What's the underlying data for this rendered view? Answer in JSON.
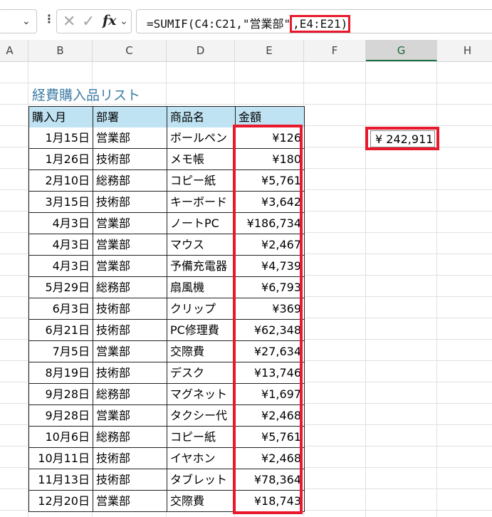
{
  "formula_bar": {
    "formula_prefix": "=SUMIF(C4:C21,\"営業部\"",
    "formula_highlight": ",E4:E21)",
    "fx_label": "fx"
  },
  "icons": {
    "namebox": "chevron-down-icon",
    "menu": "vertical-dots-icon",
    "cancel": "cancel-x-icon",
    "enter": "checkmark-icon",
    "function": "fx-icon"
  },
  "columns": [
    "A",
    "B",
    "C",
    "D",
    "E",
    "F",
    "G",
    "H"
  ],
  "selected_column": "G",
  "sheet": {
    "title": "経費購入品リスト",
    "headers": [
      "購入月",
      "部署",
      "商品名",
      "金額"
    ],
    "rows": [
      {
        "date": "1月15日",
        "dept": "営業部",
        "item": "ボールペン",
        "amount": "¥126"
      },
      {
        "date": "1月26日",
        "dept": "技術部",
        "item": "メモ帳",
        "amount": "¥180"
      },
      {
        "date": "2月10日",
        "dept": "総務部",
        "item": "コピー紙",
        "amount": "¥5,761"
      },
      {
        "date": "3月15日",
        "dept": "技術部",
        "item": "キーボード",
        "amount": "¥3,642"
      },
      {
        "date": "4月3日",
        "dept": "営業部",
        "item": "ノートPC",
        "amount": "¥186,734"
      },
      {
        "date": "4月3日",
        "dept": "営業部",
        "item": "マウス",
        "amount": "¥2,467"
      },
      {
        "date": "4月3日",
        "dept": "営業部",
        "item": "予備充電器",
        "amount": "¥4,739"
      },
      {
        "date": "5月29日",
        "dept": "総務部",
        "item": "扇風機",
        "amount": "¥6,793"
      },
      {
        "date": "6月3日",
        "dept": "技術部",
        "item": "クリップ",
        "amount": "¥369"
      },
      {
        "date": "6月21日",
        "dept": "技術部",
        "item": "PC修理費",
        "amount": "¥62,348"
      },
      {
        "date": "7月5日",
        "dept": "営業部",
        "item": "交際費",
        "amount": "¥27,634"
      },
      {
        "date": "8月19日",
        "dept": "技術部",
        "item": "デスク",
        "amount": "¥13,746"
      },
      {
        "date": "9月28日",
        "dept": "総務部",
        "item": "マグネット",
        "amount": "¥1,697"
      },
      {
        "date": "9月28日",
        "dept": "営業部",
        "item": "タクシー代",
        "amount": "¥2,468"
      },
      {
        "date": "10月6日",
        "dept": "総務部",
        "item": "コピー紙",
        "amount": "¥5,761"
      },
      {
        "date": "10月11日",
        "dept": "技術部",
        "item": "イヤホン",
        "amount": "¥2,468"
      },
      {
        "date": "11月13日",
        "dept": "技術部",
        "item": "タブレット",
        "amount": "¥78,364"
      },
      {
        "date": "12月20日",
        "dept": "営業部",
        "item": "交際費",
        "amount": "¥18,743"
      }
    ]
  },
  "result_cell": {
    "value": "¥ 242,911"
  },
  "colors": {
    "highlight": "#e8192c",
    "header_fill": "#bfe3f2",
    "title_text": "#3f7ea6",
    "selected_column_accent": "#1e7145"
  }
}
